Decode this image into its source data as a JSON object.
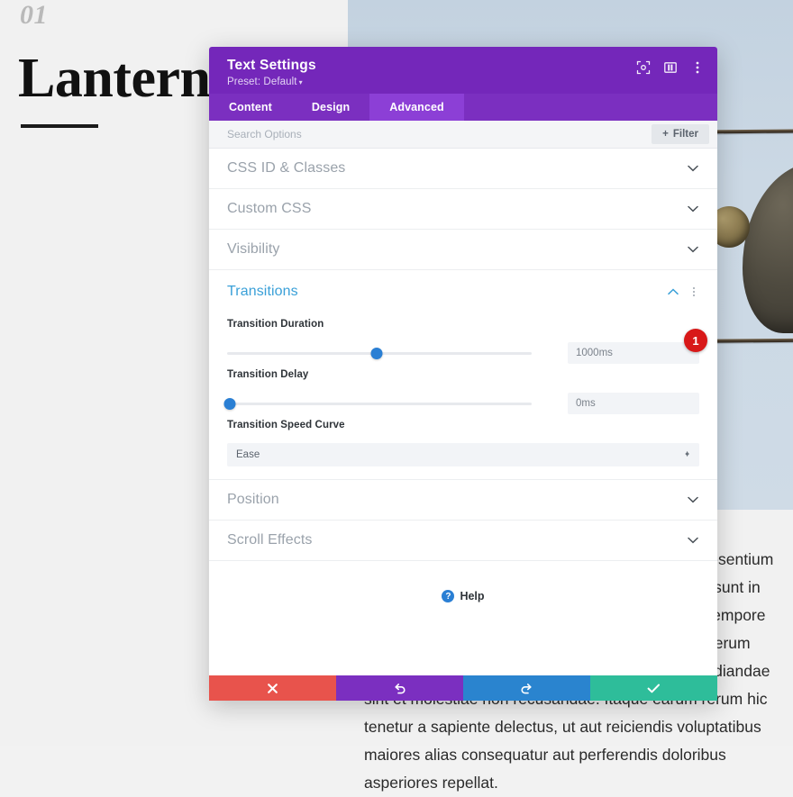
{
  "background": {
    "hero_number": "01",
    "hero_title": "Lanterns",
    "body_text": "Eaque ipsa quae ab illo ducimus qui blanditiis praesentium voluptatum deleniti atque non provident, similique sunt in culpa facilis est et expedita distinctio. Nam libero tempore placeat facere possimus omnis officiis debitis aut rerum necessitatibus saepe eveniet ut et voluptates repudiandae sint et molestiae non recusandae. Itaque earum rerum hic tenetur a sapiente delectus, ut aut reiciendis voluptatibus maiores alias consequatur aut perferendis doloribus asperiores repellat."
  },
  "modal": {
    "title": "Text Settings",
    "preset_label": "Preset: Default",
    "preset_caret": "▾",
    "header_icons": [
      {
        "name": "focus-icon"
      },
      {
        "name": "layout-panel-icon"
      },
      {
        "name": "kebab-menu-icon"
      }
    ],
    "tabs": [
      {
        "label": "Content",
        "active": false
      },
      {
        "label": "Design",
        "active": false
      },
      {
        "label": "Advanced",
        "active": true
      }
    ],
    "search": {
      "placeholder": "Search Options",
      "value": "",
      "filter_label": "Filter",
      "filter_plus": "+"
    },
    "sections": [
      {
        "label": "CSS ID & Classes",
        "open": false
      },
      {
        "label": "Custom CSS",
        "open": false
      },
      {
        "label": "Visibility",
        "open": false
      }
    ],
    "transitions": {
      "label": "Transitions",
      "open": true,
      "duration": {
        "label": "Transition Duration",
        "value": "1000ms",
        "slider_percent": 49
      },
      "delay": {
        "label": "Transition Delay",
        "value": "0ms",
        "slider_percent": 1
      },
      "speed_curve": {
        "label": "Transition Speed Curve",
        "value": "Ease"
      }
    },
    "sections_bottom": [
      {
        "label": "Position",
        "open": false
      },
      {
        "label": "Scroll Effects",
        "open": false
      }
    ],
    "help": {
      "label": "Help",
      "icon_glyph": "?"
    },
    "footer_buttons": [
      {
        "name": "cancel-button",
        "icon": "close-icon",
        "color": "#e8534c"
      },
      {
        "name": "undo-button",
        "icon": "undo-icon",
        "color": "#7b2fc0"
      },
      {
        "name": "redo-button",
        "icon": "redo-icon",
        "color": "#2a84cf"
      },
      {
        "name": "save-button",
        "icon": "check-icon",
        "color": "#2ebd9a"
      }
    ]
  },
  "annotations": {
    "badge_1": "1"
  },
  "colors": {
    "header_purple": "#7427ba",
    "tab_bar_purple": "#7b2fc0",
    "tab_active_purple": "#8c3fd6",
    "accent_blue": "#2a7fd4",
    "section_open_blue": "#3aa0d8",
    "badge_red": "#d81818",
    "cancel_red": "#e8534c",
    "undo_purple": "#7b2fc0",
    "redo_blue": "#2a84cf",
    "save_green": "#2ebd9a"
  }
}
